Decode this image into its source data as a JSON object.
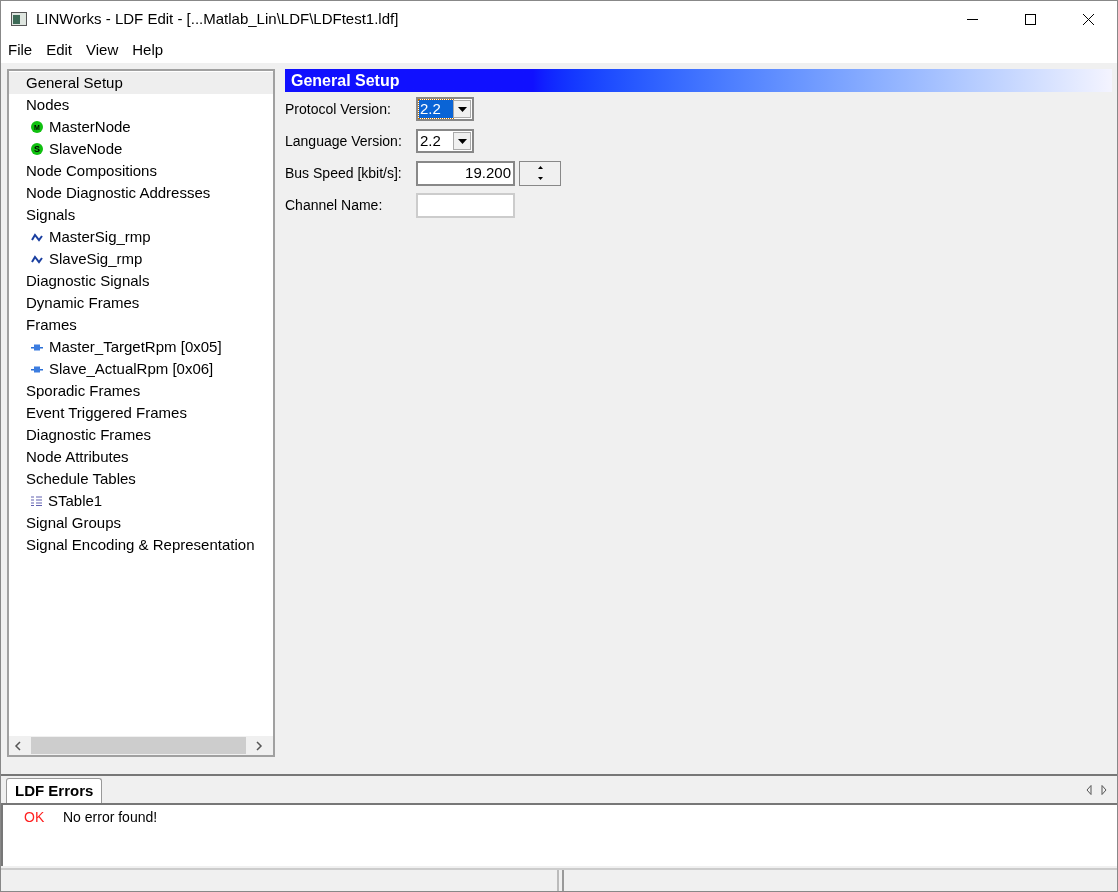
{
  "window": {
    "title": "LINWorks - LDF Edit - [...Matlab_Lin\\LDF\\LDFtest1.ldf]"
  },
  "menu": [
    "File",
    "Edit",
    "View",
    "Help"
  ],
  "tree": [
    {
      "label": "General Setup",
      "selected": true
    },
    {
      "label": "Nodes",
      "selected": false,
      "children": [
        {
          "label": "MasterNode",
          "kind": "master",
          "badge": "M",
          "selected": false
        },
        {
          "label": "SlaveNode",
          "kind": "slave",
          "badge": "S",
          "selected": false
        }
      ]
    },
    {
      "label": "Node Compositions",
      "selected": false
    },
    {
      "label": "Node Diagnostic Addresses",
      "selected": false
    },
    {
      "label": "Signals",
      "selected": false,
      "children": [
        {
          "label": "MasterSig_rmp",
          "kind": "signal",
          "selected": false
        },
        {
          "label": "SlaveSig_rmp",
          "kind": "signal",
          "selected": false
        }
      ]
    },
    {
      "label": "Diagnostic Signals",
      "selected": false
    },
    {
      "label": "Dynamic Frames",
      "selected": false
    },
    {
      "label": "Frames",
      "selected": false,
      "children": [
        {
          "label": "Master_TargetRpm [0x05]",
          "kind": "frame",
          "selected": false
        },
        {
          "label": "Slave_ActualRpm [0x06]",
          "kind": "frame",
          "selected": false
        }
      ]
    },
    {
      "label": "Sporadic Frames",
      "selected": false
    },
    {
      "label": "Event Triggered Frames",
      "selected": false
    },
    {
      "label": "Diagnostic Frames",
      "selected": false
    },
    {
      "label": "Node Attributes",
      "selected": false
    },
    {
      "label": "Schedule Tables",
      "selected": false,
      "children": [
        {
          "label": "STable1",
          "kind": "schedule",
          "selected": false
        }
      ]
    },
    {
      "label": "Signal Groups",
      "selected": false
    },
    {
      "label": "Signal Encoding & Representation",
      "selected": false
    }
  ],
  "panel": {
    "title": "General Setup",
    "fields": [
      {
        "label": "Protocol Version:",
        "kind": "dropdown",
        "value": "2.2",
        "focused": true
      },
      {
        "label": "Language Version:",
        "kind": "dropdown",
        "value": "2.2",
        "focused": false
      },
      {
        "label": "Bus Speed [kbit/s]:",
        "kind": "spinner",
        "value": "19.200",
        "focused": false
      },
      {
        "label": "Channel Name:",
        "kind": "text",
        "focused": false
      }
    ]
  },
  "bottom": {
    "tabs": [
      {
        "label": "LDF Errors",
        "selected": true
      }
    ],
    "messages": [
      {
        "status": "OK",
        "text": "No error found!"
      }
    ]
  }
}
